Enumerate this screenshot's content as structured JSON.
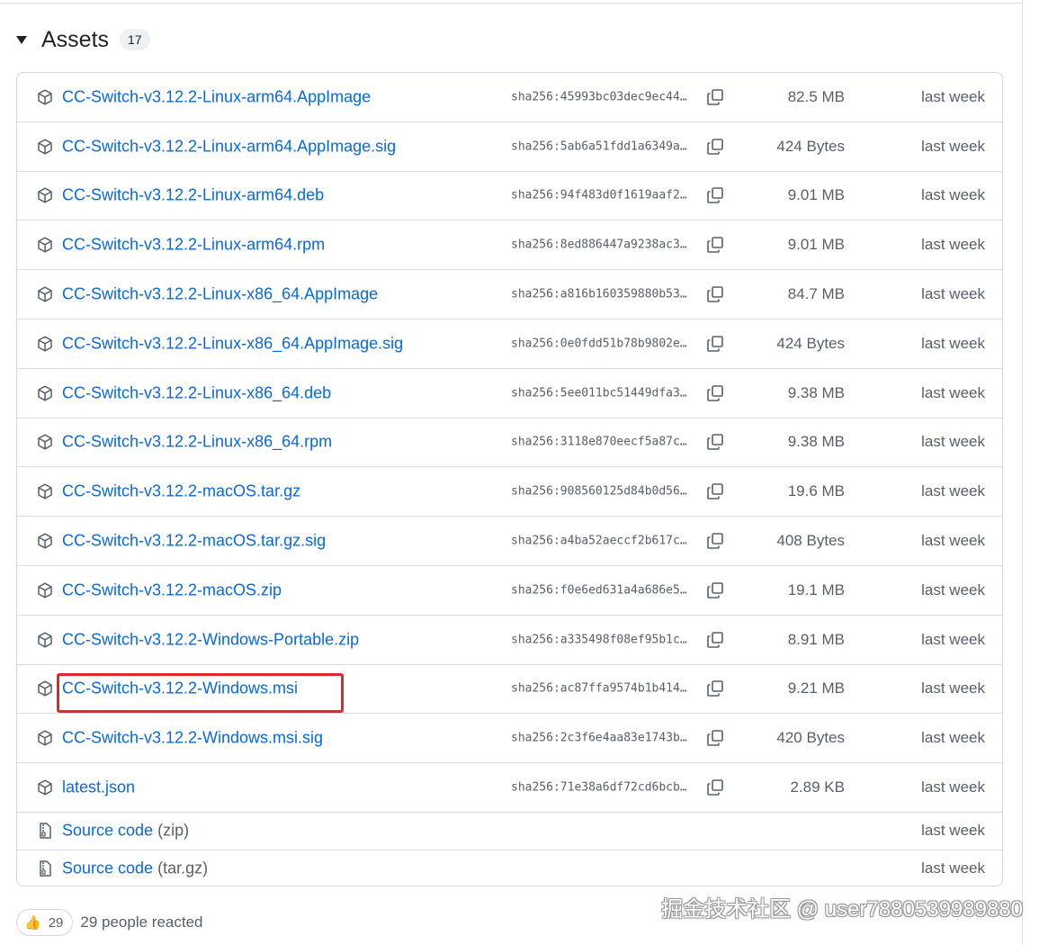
{
  "header": {
    "title": "Assets",
    "count": "17"
  },
  "assets": [
    {
      "name": "CC-Switch-v3.12.2-Linux-arm64.AppImage",
      "sha": "sha256:45993bc03dec9ec44…",
      "size": "82.5 MB",
      "date": "last week"
    },
    {
      "name": "CC-Switch-v3.12.2-Linux-arm64.AppImage.sig",
      "sha": "sha256:5ab6a51fdd1a6349a…",
      "size": "424 Bytes",
      "date": "last week"
    },
    {
      "name": "CC-Switch-v3.12.2-Linux-arm64.deb",
      "sha": "sha256:94f483d0f1619aaf2…",
      "size": "9.01 MB",
      "date": "last week"
    },
    {
      "name": "CC-Switch-v3.12.2-Linux-arm64.rpm",
      "sha": "sha256:8ed886447a9238ac3…",
      "size": "9.01 MB",
      "date": "last week"
    },
    {
      "name": "CC-Switch-v3.12.2-Linux-x86_64.AppImage",
      "sha": "sha256:a816b160359880b53…",
      "size": "84.7 MB",
      "date": "last week"
    },
    {
      "name": "CC-Switch-v3.12.2-Linux-x86_64.AppImage.sig",
      "sha": "sha256:0e0fdd51b78b9802e…",
      "size": "424 Bytes",
      "date": "last week"
    },
    {
      "name": "CC-Switch-v3.12.2-Linux-x86_64.deb",
      "sha": "sha256:5ee011bc51449dfa3…",
      "size": "9.38 MB",
      "date": "last week"
    },
    {
      "name": "CC-Switch-v3.12.2-Linux-x86_64.rpm",
      "sha": "sha256:3118e870eecf5a87c…",
      "size": "9.38 MB",
      "date": "last week"
    },
    {
      "name": "CC-Switch-v3.12.2-macOS.tar.gz",
      "sha": "sha256:908560125d84b0d56…",
      "size": "19.6 MB",
      "date": "last week"
    },
    {
      "name": "CC-Switch-v3.12.2-macOS.tar.gz.sig",
      "sha": "sha256:a4ba52aeccf2b617c…",
      "size": "408 Bytes",
      "date": "last week"
    },
    {
      "name": "CC-Switch-v3.12.2-macOS.zip",
      "sha": "sha256:f0e6ed631a4a686e5…",
      "size": "19.1 MB",
      "date": "last week"
    },
    {
      "name": "CC-Switch-v3.12.2-Windows-Portable.zip",
      "sha": "sha256:a335498f08ef95b1c…",
      "size": "8.91 MB",
      "date": "last week"
    },
    {
      "name": "CC-Switch-v3.12.2-Windows.msi",
      "sha": "sha256:ac87ffa9574b1b414…",
      "size": "9.21 MB",
      "date": "last week"
    },
    {
      "name": "CC-Switch-v3.12.2-Windows.msi.sig",
      "sha": "sha256:2c3f6e4aa83e1743b…",
      "size": "420 Bytes",
      "date": "last week"
    },
    {
      "name": "latest.json",
      "sha": "sha256:71e38a6df72cd6bcb…",
      "size": "2.89 KB",
      "date": "last week"
    }
  ],
  "source_code": [
    {
      "label": "Source code",
      "suffix": "(zip)",
      "date": "last week"
    },
    {
      "label": "Source code",
      "suffix": "(tar.gz)",
      "date": "last week"
    }
  ],
  "reactions": {
    "emoji": "👍",
    "count": "29",
    "text": "29 people reacted"
  },
  "watermark": "掘金技术社区 @ user7880539989880",
  "colors": {
    "link": "#0969da",
    "muted": "#57606a",
    "border": "#d0d7de",
    "highlight": "#e0262f"
  },
  "icons": {
    "asset": "package-icon",
    "source": "file-zip-icon",
    "copy": "copy-icon"
  }
}
